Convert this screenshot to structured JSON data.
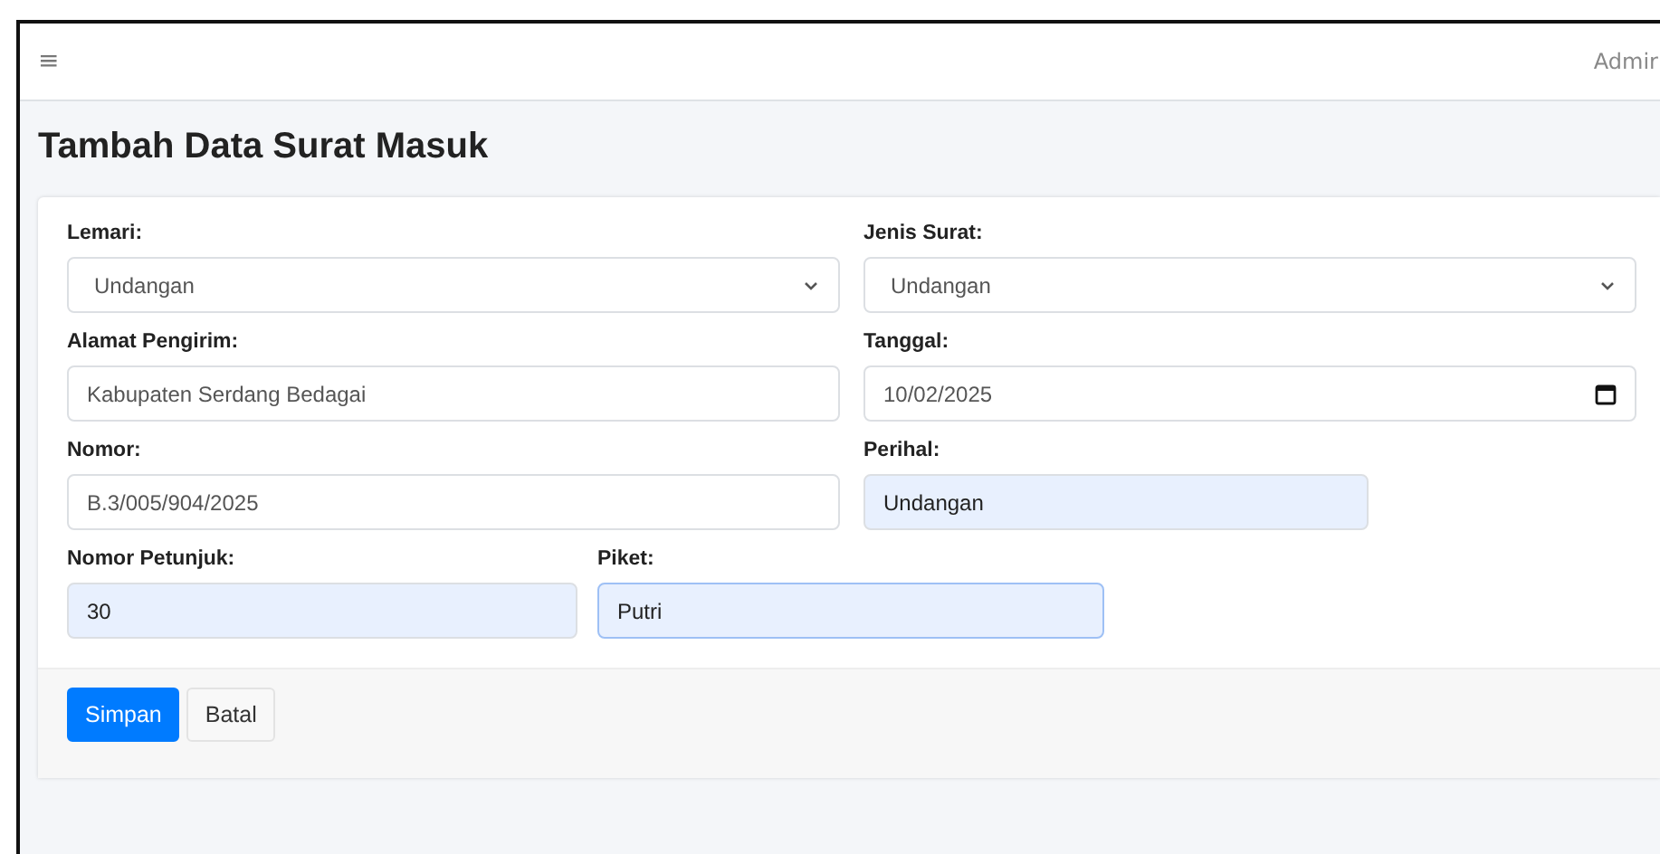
{
  "topbar": {
    "menu_icon": "≡",
    "user": "Admir"
  },
  "title": "Tambah Data Surat Masuk",
  "rows": [
    [
      {
        "label": "Lemari:",
        "kind": "select",
        "value": "Undangan",
        "autofilled": false,
        "focused": false
      },
      {
        "label": "Jenis Surat:",
        "kind": "select",
        "value": "Undangan",
        "autofilled": false,
        "focused": false
      }
    ],
    [
      {
        "label": "Alamat Pengirim:",
        "kind": "text",
        "value": "Kabupaten Serdang Bedagai",
        "autofilled": false,
        "focused": false
      },
      {
        "label": "Tanggal:",
        "kind": "date",
        "value": "10/02/2025",
        "autofilled": false,
        "focused": false
      }
    ],
    [
      {
        "label": "Nomor:",
        "kind": "text",
        "value": "B.3/005/904/2025",
        "autofilled": false,
        "focused": false
      },
      {
        "label": "Perihal:",
        "kind": "text",
        "value": "Undangan",
        "autofilled": true,
        "focused": false
      }
    ],
    [
      {
        "label": "Nomor Petunjuk:",
        "kind": "text",
        "value": "30",
        "autofilled": true,
        "focused": false
      },
      {
        "label": "Piket:",
        "kind": "text",
        "value": "Putri",
        "autofilled": true,
        "focused": true
      }
    ]
  ],
  "buttons": [
    {
      "label": "Simpan",
      "kind": "primary"
    },
    {
      "label": "Batal",
      "kind": "secondary"
    }
  ]
}
